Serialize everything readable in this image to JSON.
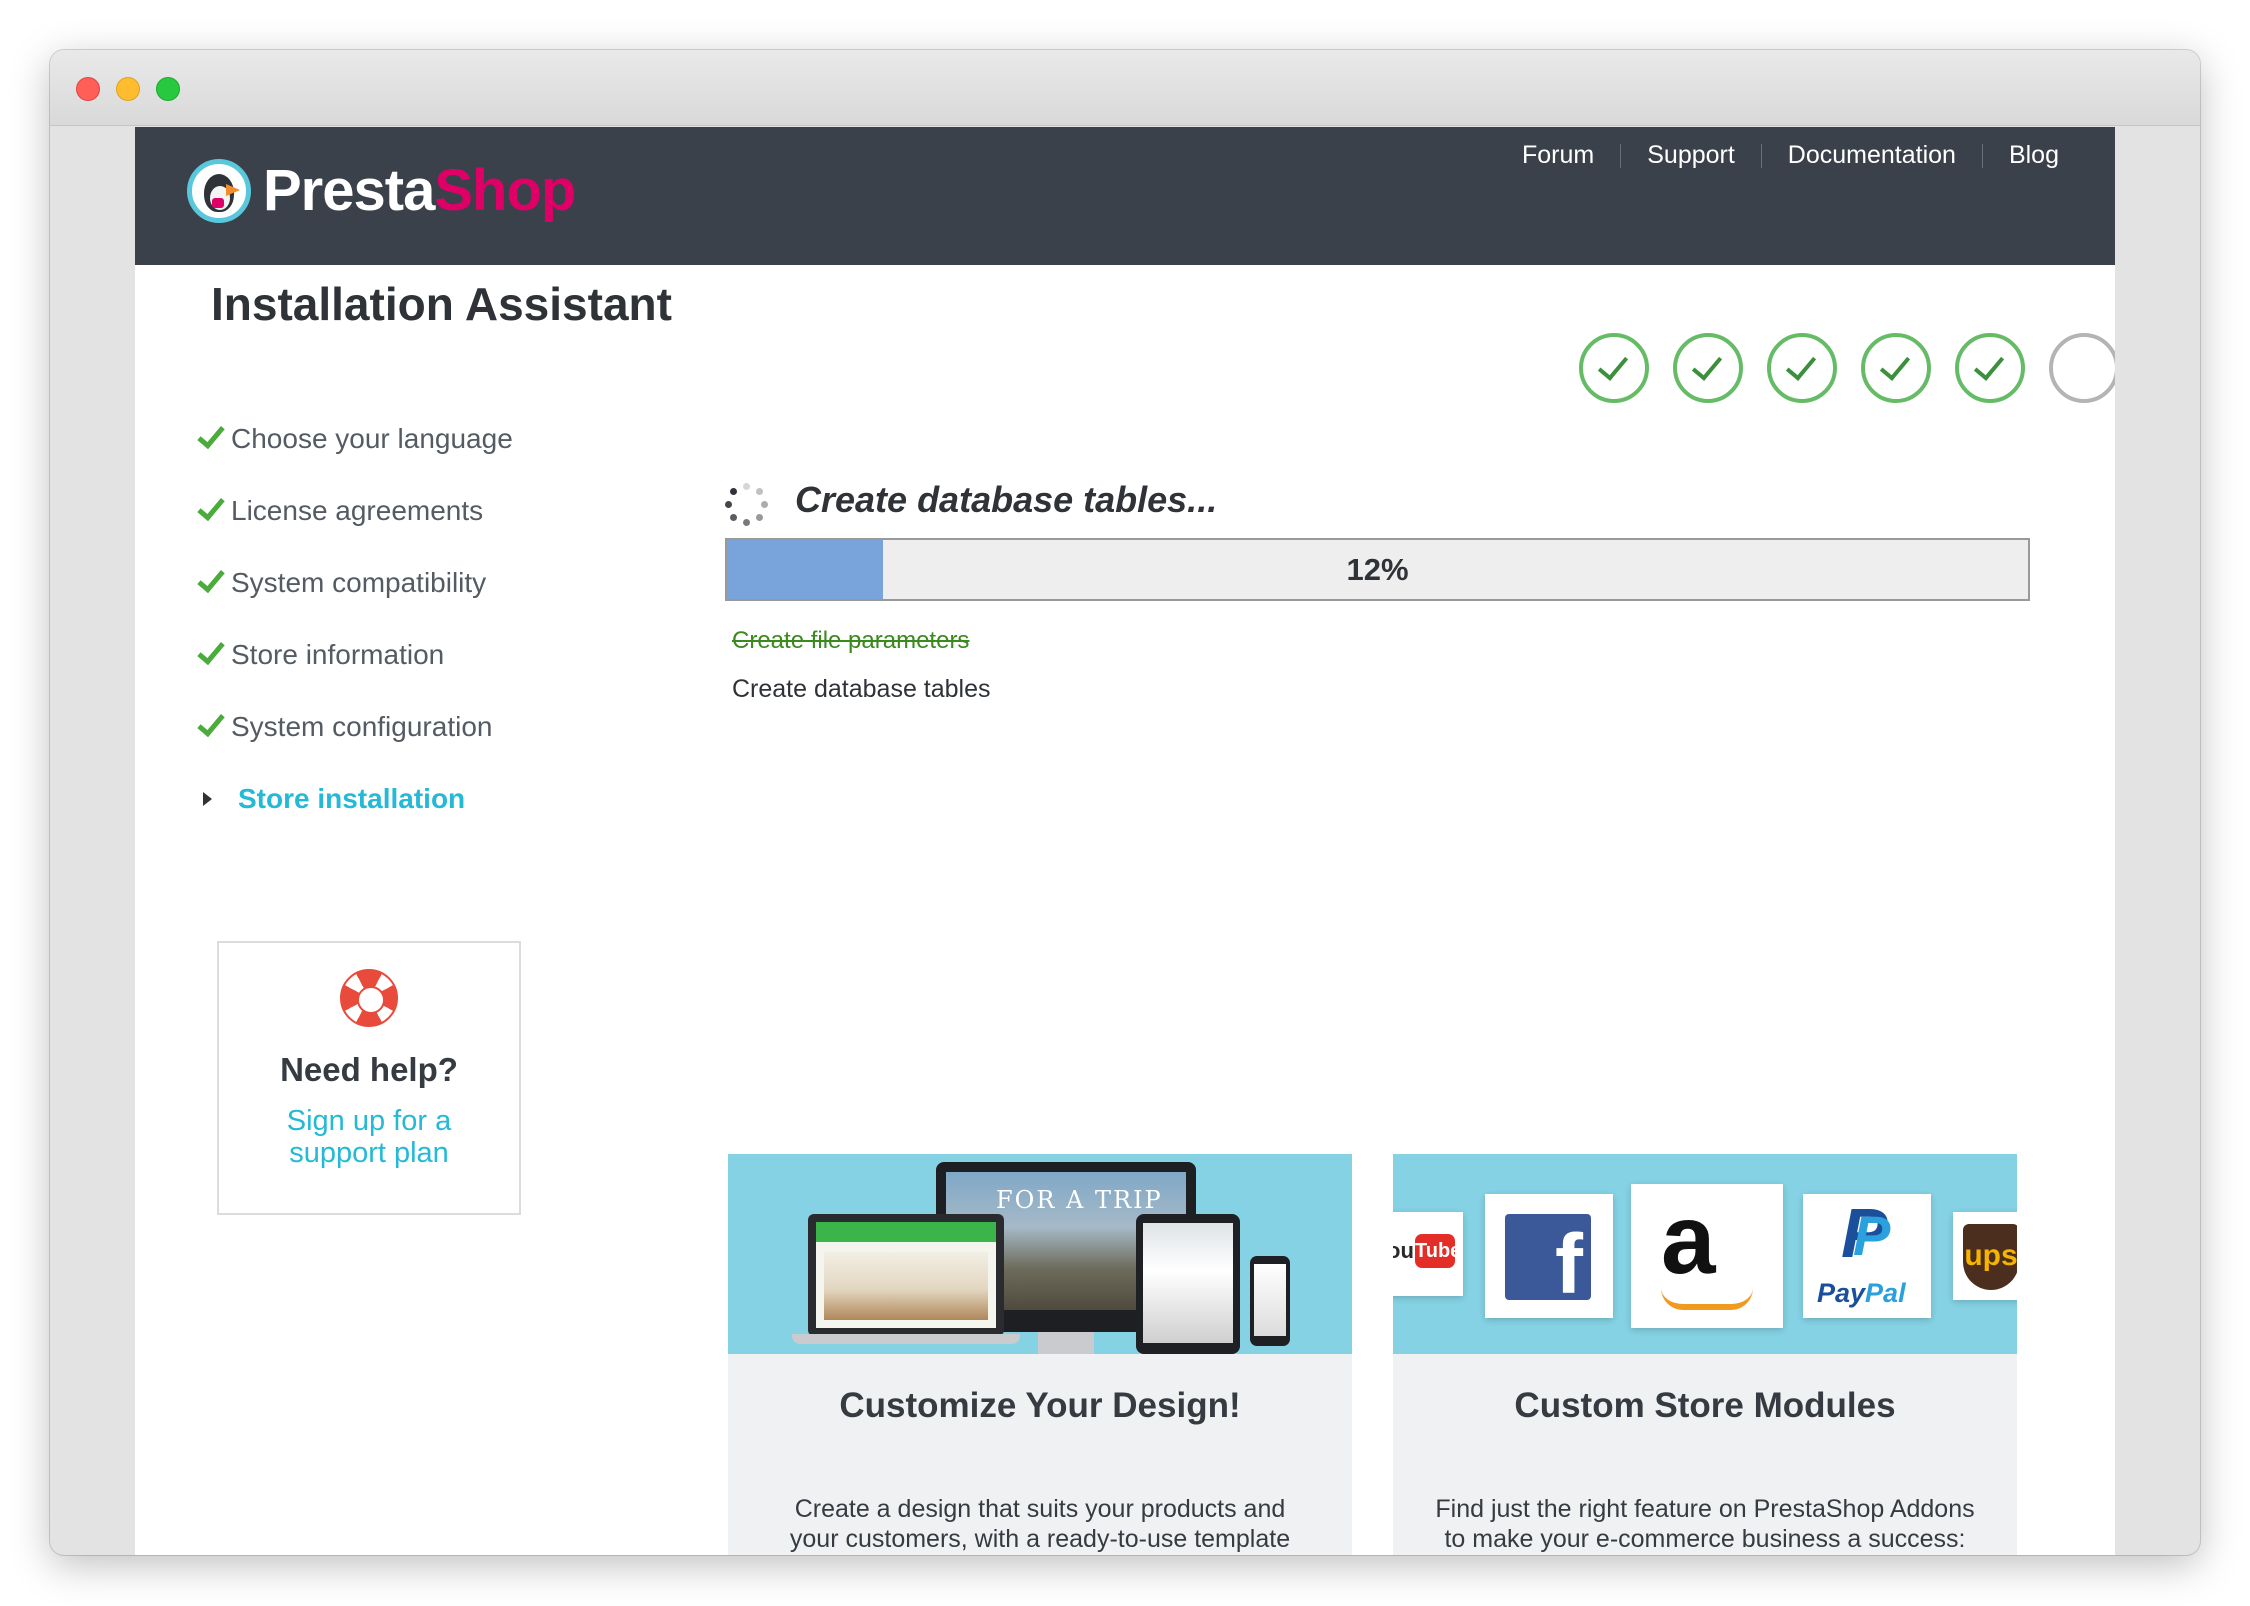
{
  "header": {
    "logo_presta": "Presta",
    "logo_shop": "Shop",
    "nav": [
      "Forum",
      "Support",
      "Documentation",
      "Blog"
    ]
  },
  "page_title": "Installation Assistant",
  "steps": {
    "total": 6,
    "completed": 5
  },
  "sidebar": {
    "items": [
      {
        "label": "Choose your language",
        "status": "done"
      },
      {
        "label": "License agreements",
        "status": "done"
      },
      {
        "label": "System compatibility",
        "status": "done"
      },
      {
        "label": "Store information",
        "status": "done"
      },
      {
        "label": "System configuration",
        "status": "done"
      },
      {
        "label": "Store installation",
        "status": "active"
      }
    ]
  },
  "help": {
    "title": "Need help?",
    "link": "Sign up for a support plan"
  },
  "progress": {
    "title": "Create database tables...",
    "percent_label": "12%",
    "percent": 12,
    "tasks_done": [
      "Create file parameters"
    ],
    "task_current": "Create database tables"
  },
  "cards": [
    {
      "title": "Customize Your Design!",
      "text": "Create a design that suits your products and your customers, with a ready-to-use template theme.",
      "image_text": "FOR A TRIP"
    },
    {
      "title": "Custom Store Modules",
      "text": "Find just the right feature on PrestaShop Addons to make your e-commerce business a success:",
      "tiles": {
        "youtube_prefix": "ou",
        "youtube_box": "Tube",
        "facebook": "f",
        "amazon": "a",
        "paypal_pay": "Pay",
        "paypal_pal": "Pal",
        "ups": "ups"
      }
    }
  ],
  "colors": {
    "header_bg": "#3b414a",
    "brand_pink": "#df0067",
    "accent_blue": "#25b9d7",
    "check_green": "#66bb66",
    "progress_fill": "#79a4db"
  }
}
